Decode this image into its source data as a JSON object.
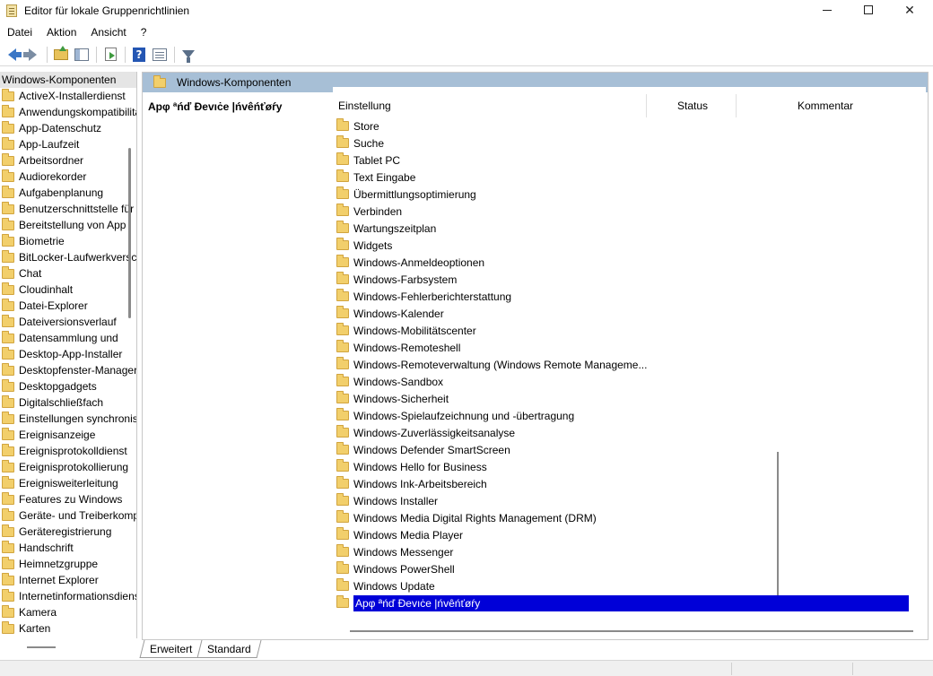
{
  "window": {
    "title": "Editor für lokale Gruppenrichtlinien"
  },
  "menu": [
    "Datei",
    "Aktion",
    "Ansicht",
    "?"
  ],
  "tree": {
    "header": "Windows-Komponenten",
    "items": [
      "ActiveX-Installerdienst",
      "Anwendungskompatibilität",
      "App-Datenschutz",
      "App-Laufzeit",
      "Arbeitsordner",
      "Audiorekorder",
      "Aufgabenplanung",
      "Benutzerschnittstelle für",
      "Bereitstellung von App",
      "Biometrie",
      "BitLocker-Laufwerkverschlüsselung",
      "Chat",
      "Cloudinhalt",
      "Datei-Explorer",
      "Dateiversionsverlauf",
      "Datensammlung und",
      "Desktop-App-Installer",
      "Desktopfenster-Manager",
      "Desktopgadgets",
      "Digitalschließfach",
      "Einstellungen synchronisieren",
      "Ereignisanzeige",
      "Ereignisprotokolldienst",
      "Ereignisprotokollierung",
      "Ereignisweiterleitung",
      "Features zu Windows",
      "Geräte- und Treiberkompatibilität",
      "Geräteregistrierung",
      "Handschrift",
      "Heimnetzgruppe",
      "Internet Explorer",
      "Internetinformationsdienste",
      "Kamera",
      "Karten"
    ]
  },
  "main": {
    "header": "Windows-Komponenten",
    "description_title": "Apφ ªńď Ðevıċe |ńvêńťøŕy",
    "columns": {
      "setting": "Einstellung",
      "status": "Status",
      "comment": "Kommentar"
    },
    "rows": [
      "Store",
      "Suche",
      "Tablet PC",
      "Text Eingabe",
      "Übermittlungsoptimierung",
      "Verbinden",
      "Wartungszeitplan",
      "Widgets",
      "Windows-Anmeldeoptionen",
      "Windows-Farbsystem",
      "Windows-Fehlerberichterstattung",
      "Windows-Kalender",
      "Windows-Mobilitätscenter",
      "Windows-Remoteshell",
      "Windows-Remoteverwaltung (Windows Remote Manageme...",
      "Windows-Sandbox",
      "Windows-Sicherheit",
      "Windows-Spielaufzeichnung und -übertragung",
      "Windows-Zuverlässigkeitsanalyse",
      "Windows Defender SmartScreen",
      "Windows Hello for Business",
      "Windows Ink-Arbeitsbereich",
      "Windows Installer",
      "Windows Media Digital Rights Management (DRM)",
      "Windows Media Player",
      "Windows Messenger",
      "Windows PowerShell",
      "Windows Update"
    ],
    "selected_row": "Apφ ªńď Ðevıċe |ńvêńťøŕy"
  },
  "tabs": [
    "Erweitert",
    "Standard"
  ],
  "colors": {
    "header_blue": "#a7bfd6",
    "selection": "#0000d8",
    "folder": "#f2cf6b"
  }
}
